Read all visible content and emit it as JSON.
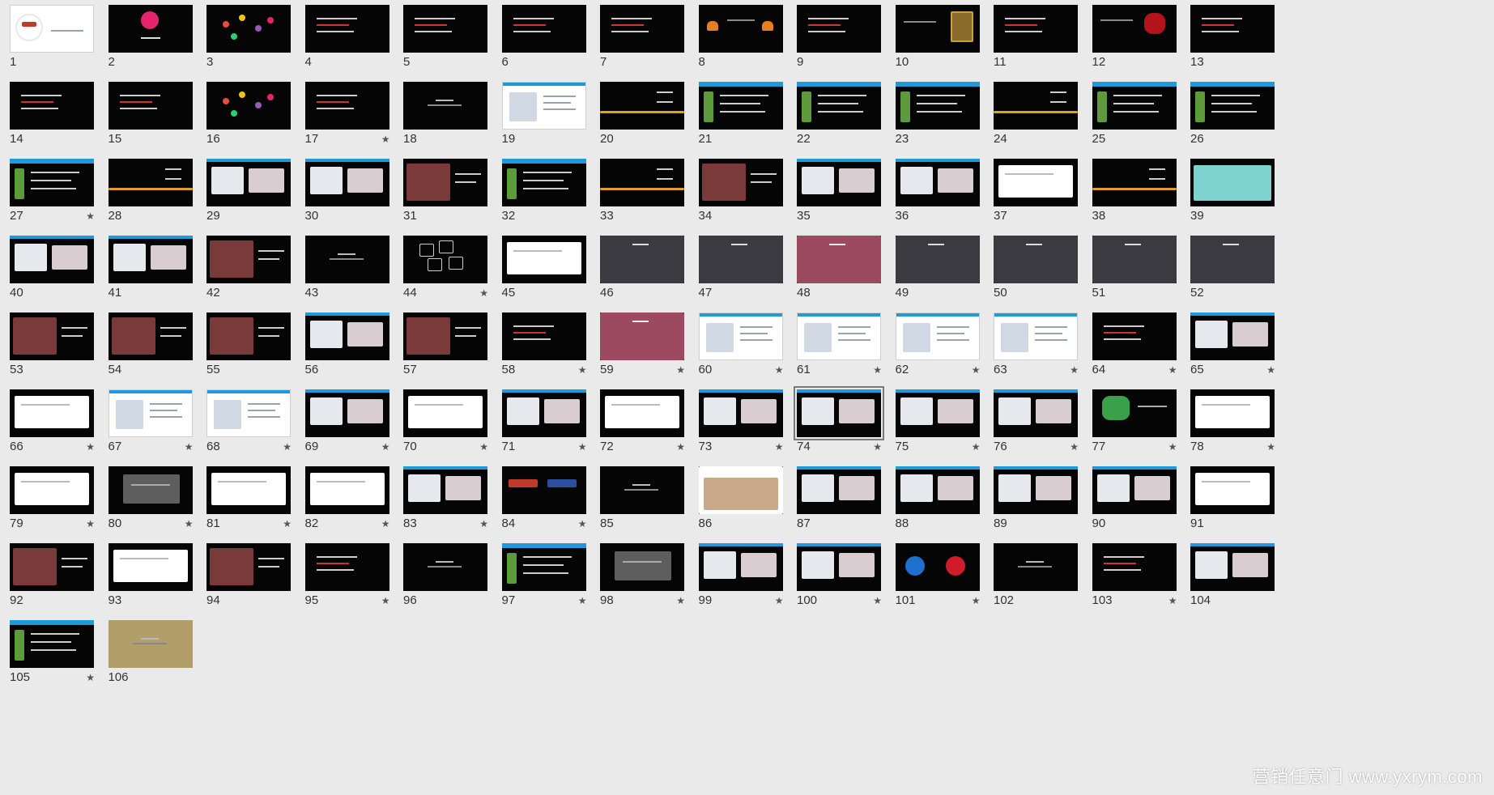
{
  "watermark": "营销任意门 www.yxrym.com",
  "colors": {
    "background": "#eaeaea",
    "dark_slide": "#050505",
    "light_slide": "#ffffff",
    "gold_slide": "#b29e6a",
    "accent_bar": "#1e9ad8",
    "number_text": "#333333"
  },
  "icons": {
    "star": "★"
  },
  "selected_slide": 74,
  "slides": [
    {
      "n": "1",
      "theme": "light",
      "star": false,
      "variant": "logo"
    },
    {
      "n": "2",
      "theme": "dark",
      "star": false,
      "variant": "circle"
    },
    {
      "n": "3",
      "theme": "dark",
      "star": false,
      "variant": "dots"
    },
    {
      "n": "4",
      "theme": "dark",
      "star": false,
      "variant": "text"
    },
    {
      "n": "5",
      "theme": "dark",
      "star": false,
      "variant": "text"
    },
    {
      "n": "6",
      "theme": "dark",
      "star": false,
      "variant": "text"
    },
    {
      "n": "7",
      "theme": "dark",
      "star": false,
      "variant": "text"
    },
    {
      "n": "8",
      "theme": "dark",
      "star": false,
      "variant": "hearts"
    },
    {
      "n": "9",
      "theme": "dark",
      "star": false,
      "variant": "text"
    },
    {
      "n": "10",
      "theme": "dark",
      "star": false,
      "variant": "frame"
    },
    {
      "n": "11",
      "theme": "dark",
      "star": false,
      "variant": "text"
    },
    {
      "n": "12",
      "theme": "dark",
      "star": false,
      "variant": "redshape"
    },
    {
      "n": "13",
      "theme": "dark",
      "star": false,
      "variant": "text"
    },
    {
      "n": "14",
      "theme": "dark",
      "star": false,
      "variant": "text"
    },
    {
      "n": "15",
      "theme": "dark",
      "star": false,
      "variant": "text"
    },
    {
      "n": "16",
      "theme": "dark",
      "star": false,
      "variant": "dots"
    },
    {
      "n": "17",
      "theme": "dark",
      "star": true,
      "variant": "oval"
    },
    {
      "n": "18",
      "theme": "dark",
      "star": false,
      "variant": "title"
    },
    {
      "n": "19",
      "theme": "light",
      "star": false,
      "variant": "doc"
    },
    {
      "n": "20",
      "theme": "dark",
      "star": false,
      "variant": "orangebar"
    },
    {
      "n": "21",
      "theme": "dark",
      "star": false,
      "variant": "bluebar"
    },
    {
      "n": "22",
      "theme": "dark",
      "star": false,
      "variant": "bluebar"
    },
    {
      "n": "23",
      "theme": "dark",
      "star": false,
      "variant": "bluebar"
    },
    {
      "n": "24",
      "theme": "dark",
      "star": false,
      "variant": "orangebar"
    },
    {
      "n": "25",
      "theme": "dark",
      "star": false,
      "variant": "bluebar"
    },
    {
      "n": "26",
      "theme": "dark",
      "star": false,
      "variant": "bluebar"
    },
    {
      "n": "27",
      "theme": "dark",
      "star": true,
      "variant": "bluebar"
    },
    {
      "n": "28",
      "theme": "dark",
      "star": false,
      "variant": "orangebar"
    },
    {
      "n": "29",
      "theme": "dark",
      "star": false,
      "variant": "screens"
    },
    {
      "n": "30",
      "theme": "dark",
      "star": false,
      "variant": "screens"
    },
    {
      "n": "31",
      "theme": "dark",
      "star": false,
      "variant": "photo"
    },
    {
      "n": "32",
      "theme": "dark",
      "star": false,
      "variant": "bluebar"
    },
    {
      "n": "33",
      "theme": "dark",
      "star": false,
      "variant": "orangebar"
    },
    {
      "n": "34",
      "theme": "dark",
      "star": false,
      "variant": "photo"
    },
    {
      "n": "35",
      "theme": "dark",
      "star": false,
      "variant": "screens"
    },
    {
      "n": "36",
      "theme": "dark",
      "star": false,
      "variant": "screens"
    },
    {
      "n": "37",
      "theme": "dark",
      "star": false,
      "variant": "whitebox"
    },
    {
      "n": "38",
      "theme": "dark",
      "star": false,
      "variant": "orangebar"
    },
    {
      "n": "39",
      "theme": "dark",
      "star": false,
      "variant": "teal"
    },
    {
      "n": "40",
      "theme": "dark",
      "star": false,
      "variant": "screens"
    },
    {
      "n": "41",
      "theme": "dark",
      "star": false,
      "variant": "screens"
    },
    {
      "n": "42",
      "theme": "dark",
      "star": false,
      "variant": "photo"
    },
    {
      "n": "43",
      "theme": "dark",
      "star": false,
      "variant": "title"
    },
    {
      "n": "44",
      "theme": "dark",
      "star": true,
      "variant": "hex"
    },
    {
      "n": "45",
      "theme": "dark",
      "star": false,
      "variant": "whitebox"
    },
    {
      "n": "46",
      "theme": "dark",
      "star": false,
      "variant": "dior"
    },
    {
      "n": "47",
      "theme": "dark",
      "star": false,
      "variant": "dior"
    },
    {
      "n": "48",
      "theme": "dark",
      "star": false,
      "variant": "diorpink"
    },
    {
      "n": "49",
      "theme": "dark",
      "star": false,
      "variant": "dior"
    },
    {
      "n": "50",
      "theme": "dark",
      "star": false,
      "variant": "dior"
    },
    {
      "n": "51",
      "theme": "dark",
      "star": false,
      "variant": "dior"
    },
    {
      "n": "52",
      "theme": "dark",
      "star": false,
      "variant": "dior"
    },
    {
      "n": "53",
      "theme": "dark",
      "star": false,
      "variant": "photo"
    },
    {
      "n": "54",
      "theme": "dark",
      "star": false,
      "variant": "photo"
    },
    {
      "n": "55",
      "theme": "dark",
      "star": false,
      "variant": "photo"
    },
    {
      "n": "56",
      "theme": "dark",
      "star": false,
      "variant": "screens"
    },
    {
      "n": "57",
      "theme": "dark",
      "star": false,
      "variant": "photo"
    },
    {
      "n": "58",
      "theme": "dark",
      "star": true,
      "variant": "text"
    },
    {
      "n": "59",
      "theme": "dark",
      "star": true,
      "variant": "diorpink"
    },
    {
      "n": "60",
      "theme": "light",
      "star": true,
      "variant": "doc"
    },
    {
      "n": "61",
      "theme": "light",
      "star": true,
      "variant": "doc"
    },
    {
      "n": "62",
      "theme": "light",
      "star": true,
      "variant": "doc"
    },
    {
      "n": "63",
      "theme": "light",
      "star": true,
      "variant": "doc"
    },
    {
      "n": "64",
      "theme": "dark",
      "star": true,
      "variant": "text"
    },
    {
      "n": "65",
      "theme": "dark",
      "star": true,
      "variant": "screens"
    },
    {
      "n": "66",
      "theme": "dark",
      "star": true,
      "variant": "whitebox"
    },
    {
      "n": "67",
      "theme": "light",
      "star": true,
      "variant": "doc"
    },
    {
      "n": "68",
      "theme": "light",
      "star": true,
      "variant": "doc"
    },
    {
      "n": "69",
      "theme": "dark",
      "star": true,
      "variant": "screens"
    },
    {
      "n": "70",
      "theme": "dark",
      "star": true,
      "variant": "whitebox"
    },
    {
      "n": "71",
      "theme": "dark",
      "star": true,
      "variant": "screens"
    },
    {
      "n": "72",
      "theme": "dark",
      "star": true,
      "variant": "whitebox"
    },
    {
      "n": "73",
      "theme": "dark",
      "star": true,
      "variant": "screens"
    },
    {
      "n": "74",
      "theme": "dark",
      "star": true,
      "variant": "screens"
    },
    {
      "n": "75",
      "theme": "dark",
      "star": true,
      "variant": "screens"
    },
    {
      "n": "76",
      "theme": "dark",
      "star": true,
      "variant": "screens"
    },
    {
      "n": "77",
      "theme": "dark",
      "star": true,
      "variant": "greenmap"
    },
    {
      "n": "78",
      "theme": "dark",
      "star": true,
      "variant": "whitebox"
    },
    {
      "n": "79",
      "theme": "dark",
      "star": true,
      "variant": "whitebox"
    },
    {
      "n": "80",
      "theme": "dark",
      "star": true,
      "variant": "greybox"
    },
    {
      "n": "81",
      "theme": "dark",
      "star": true,
      "variant": "whitebox"
    },
    {
      "n": "82",
      "theme": "dark",
      "star": true,
      "variant": "whitebox"
    },
    {
      "n": "83",
      "theme": "dark",
      "star": true,
      "variant": "screens"
    },
    {
      "n": "84",
      "theme": "dark",
      "star": true,
      "variant": "buttons"
    },
    {
      "n": "85",
      "theme": "dark",
      "star": false,
      "variant": "title"
    },
    {
      "n": "86",
      "theme": "dark",
      "star": false,
      "variant": "boutique"
    },
    {
      "n": "87",
      "theme": "dark",
      "star": false,
      "variant": "screens"
    },
    {
      "n": "88",
      "theme": "dark",
      "star": false,
      "variant": "screens"
    },
    {
      "n": "89",
      "theme": "dark",
      "star": false,
      "variant": "screens"
    },
    {
      "n": "90",
      "theme": "dark",
      "star": false,
      "variant": "screens"
    },
    {
      "n": "91",
      "theme": "dark",
      "star": false,
      "variant": "whitebox"
    },
    {
      "n": "92",
      "theme": "dark",
      "star": false,
      "variant": "photo"
    },
    {
      "n": "93",
      "theme": "dark",
      "star": false,
      "variant": "whitebox"
    },
    {
      "n": "94",
      "theme": "dark",
      "star": false,
      "variant": "photo"
    },
    {
      "n": "95",
      "theme": "dark",
      "star": true,
      "variant": "text"
    },
    {
      "n": "96",
      "theme": "dark",
      "star": false,
      "variant": "title"
    },
    {
      "n": "97",
      "theme": "dark",
      "star": true,
      "variant": "bluebar"
    },
    {
      "n": "98",
      "theme": "dark",
      "star": true,
      "variant": "greybox"
    },
    {
      "n": "99",
      "theme": "dark",
      "star": true,
      "variant": "screens"
    },
    {
      "n": "100",
      "theme": "dark",
      "star": true,
      "variant": "screens"
    },
    {
      "n": "101",
      "theme": "dark",
      "star": true,
      "variant": "pie"
    },
    {
      "n": "102",
      "theme": "dark",
      "star": false,
      "variant": "title"
    },
    {
      "n": "103",
      "theme": "dark",
      "star": true,
      "variant": "text"
    },
    {
      "n": "104",
      "theme": "dark",
      "star": false,
      "variant": "screens"
    },
    {
      "n": "105",
      "theme": "dark",
      "star": true,
      "variant": "bluebar"
    },
    {
      "n": "106",
      "theme": "gold",
      "star": false,
      "variant": "title"
    }
  ]
}
